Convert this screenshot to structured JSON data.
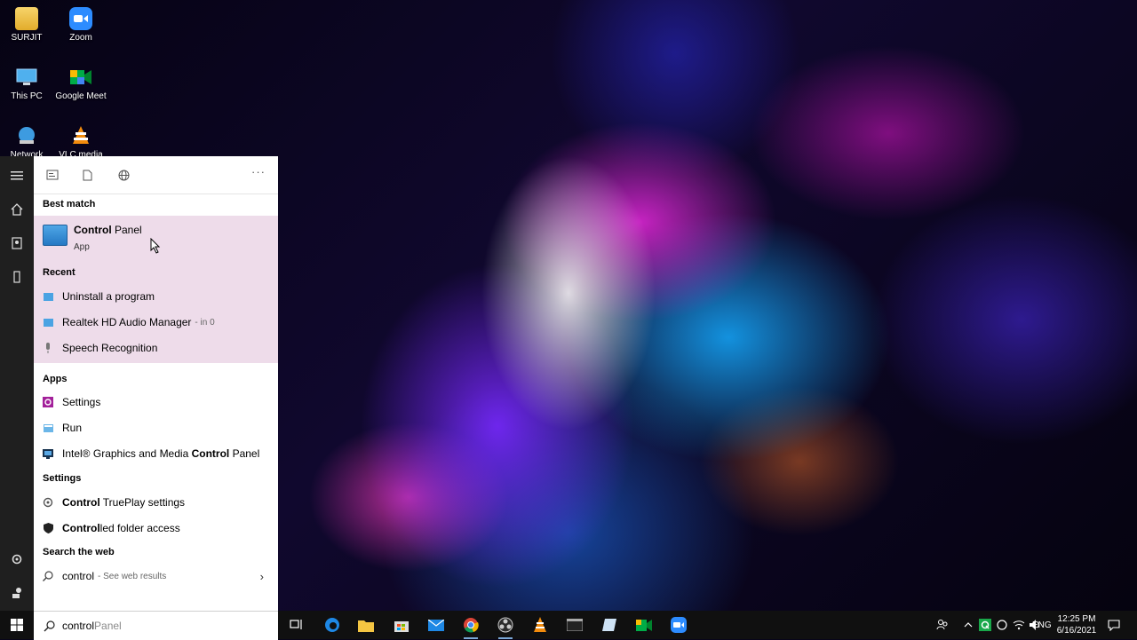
{
  "desktop": {
    "icons": [
      {
        "label": "SURJIT"
      },
      {
        "label": "Zoom"
      },
      {
        "label": "This PC"
      },
      {
        "label": "Google Meet"
      },
      {
        "label": "Network"
      },
      {
        "label": "VLC media"
      }
    ]
  },
  "start": {
    "best_match_header": "Best match",
    "best_match": {
      "title_bold": "Control",
      "title_rest": " Panel",
      "subtitle": "App"
    },
    "recent_header": "Recent",
    "recent": [
      {
        "label": "Uninstall a program"
      },
      {
        "label": "Realtek HD Audio Manager",
        "sub": "- in 0"
      },
      {
        "label": "Speech Recognition"
      }
    ],
    "apps_header": "Apps",
    "apps": [
      {
        "label": "Settings"
      },
      {
        "label": "Run"
      },
      {
        "pre": "Intel® Graphics and Media ",
        "bold": "Control",
        "post": " Panel"
      }
    ],
    "settings_header": "Settings",
    "settings": [
      {
        "bold": "Control",
        "post": " TruePlay settings"
      },
      {
        "bold": "Control",
        "post": "led folder access"
      }
    ],
    "web_header": "Search the web",
    "web": {
      "query": "control",
      "sub": "- See web results"
    },
    "more": "···"
  },
  "search": {
    "typed": "control",
    "suggestion": " Panel"
  },
  "tray": {
    "language": "ENG",
    "time": "12:25 PM",
    "date": "6/16/2021"
  },
  "colors": {
    "highlight": "#eedcea",
    "taskbar": "#101010",
    "rail": "#1f1f1f"
  }
}
